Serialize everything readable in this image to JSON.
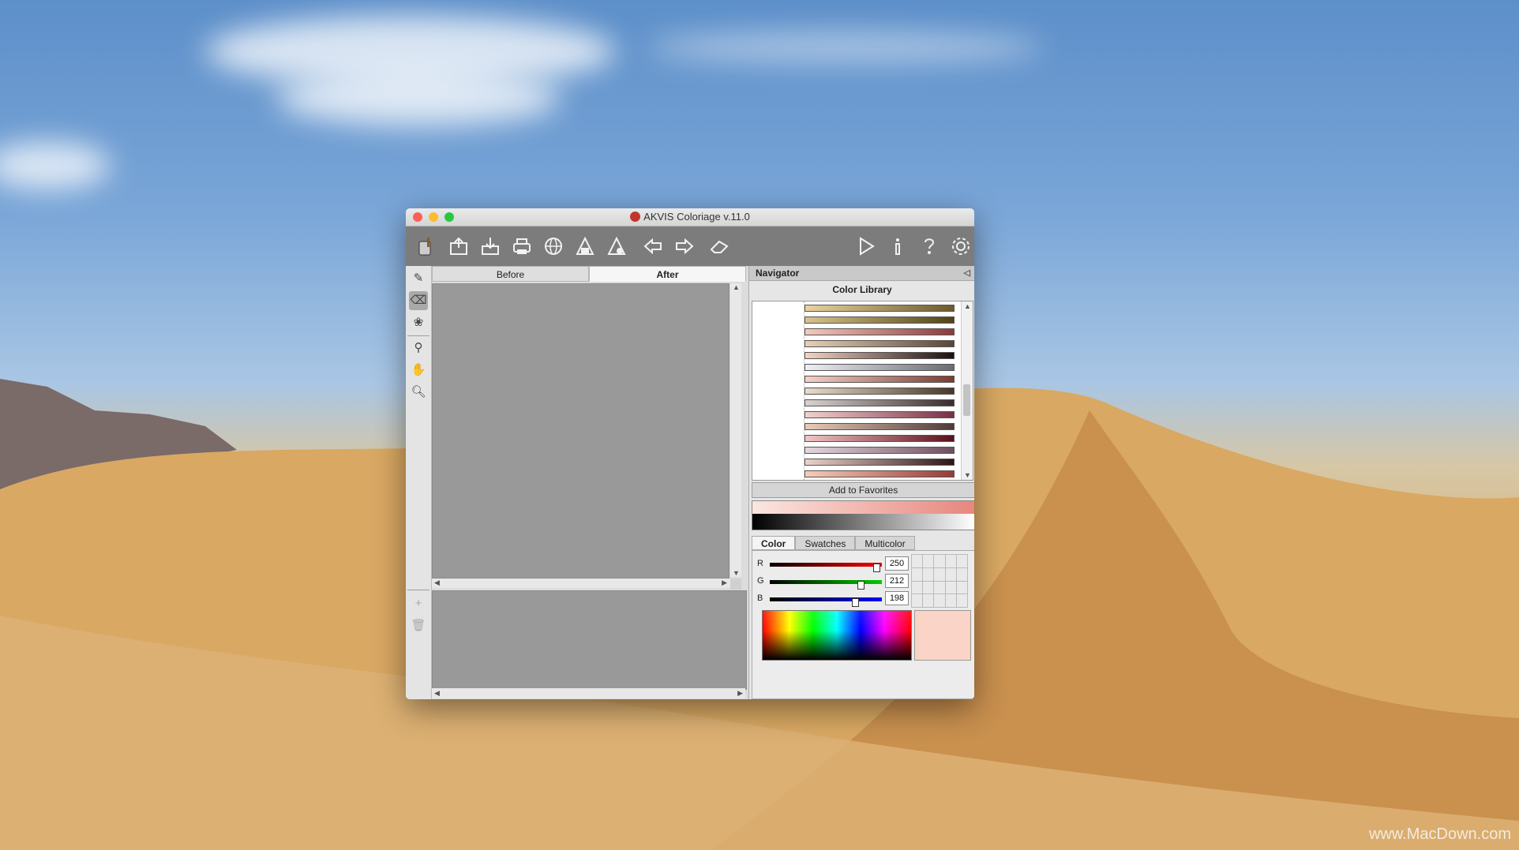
{
  "window": {
    "title": "AKVIS Coloriage v.11.0"
  },
  "toolbar": {
    "buttons": [
      {
        "name": "app-logo",
        "icon": "paint-bucket-icon"
      },
      {
        "name": "open-button",
        "icon": "open-folder-icon"
      },
      {
        "name": "save-button",
        "icon": "save-icon"
      },
      {
        "name": "print-button",
        "icon": "printer-icon"
      },
      {
        "name": "share-button",
        "icon": "globe-icon"
      },
      {
        "name": "batch-button",
        "icon": "batch-icon"
      },
      {
        "name": "export-button",
        "icon": "export-icon"
      },
      {
        "name": "undo-button",
        "icon": "arrow-left-icon"
      },
      {
        "name": "redo-button",
        "icon": "arrow-right-icon"
      },
      {
        "name": "eraser-button",
        "icon": "eraser-icon"
      },
      {
        "name": "run-button",
        "icon": "play-icon"
      },
      {
        "name": "info-button",
        "icon": "info-icon"
      },
      {
        "name": "help-button",
        "icon": "help-icon"
      },
      {
        "name": "settings-button",
        "icon": "gear-icon"
      }
    ]
  },
  "tools": [
    "pencil-icon",
    "eraser-icon",
    "color-library-icon",
    "eyedropper-icon",
    "hand-icon",
    "zoom-icon",
    "plus-icon",
    "trash-icon"
  ],
  "canvas": {
    "tab_before": "Before",
    "tab_after": "After"
  },
  "panel": {
    "navigator_label": "Navigator",
    "library_title": "Color Library",
    "add_favorites": "Add to Favorites",
    "library_gradients": [
      [
        "#e9d3a0",
        "#6b5a2a"
      ],
      [
        "#d8c38e",
        "#4f4416"
      ],
      [
        "#f3c9bf",
        "#8d3b3b"
      ],
      [
        "#e8cfb5",
        "#5a4637"
      ],
      [
        "#f5d2c0",
        "#1a0f0e"
      ],
      [
        "#eeeef6",
        "#6b6b72"
      ],
      [
        "#f4d1c7",
        "#7a3d30"
      ],
      [
        "#eadccb",
        "#493727"
      ],
      [
        "#d9d3d0",
        "#3a2d2c"
      ],
      [
        "#f2d0cd",
        "#793047"
      ],
      [
        "#e8cbb7",
        "#4e3a3a"
      ],
      [
        "#f0c6c4",
        "#5a1019"
      ],
      [
        "#e5d8df",
        "#6f4f5f"
      ],
      [
        "#ebd3cc",
        "#2c1616"
      ],
      [
        "#f6cdb9",
        "#9a3a34"
      ]
    ],
    "gradient_bar_top": [
      "#fbe6e0",
      "#e7877d"
    ],
    "color_tabs": [
      "Color",
      "Swatches",
      "Multicolor"
    ],
    "active_color_tab": "Color",
    "rgb": {
      "r_label": "R",
      "r_value": "250",
      "r_level": 250,
      "g_label": "G",
      "g_value": "212",
      "g_level": 212,
      "b_label": "B",
      "b_value": "198",
      "b_level": 198
    },
    "current_color": "#fad4c6"
  },
  "watermark": "www.MacDown.com"
}
